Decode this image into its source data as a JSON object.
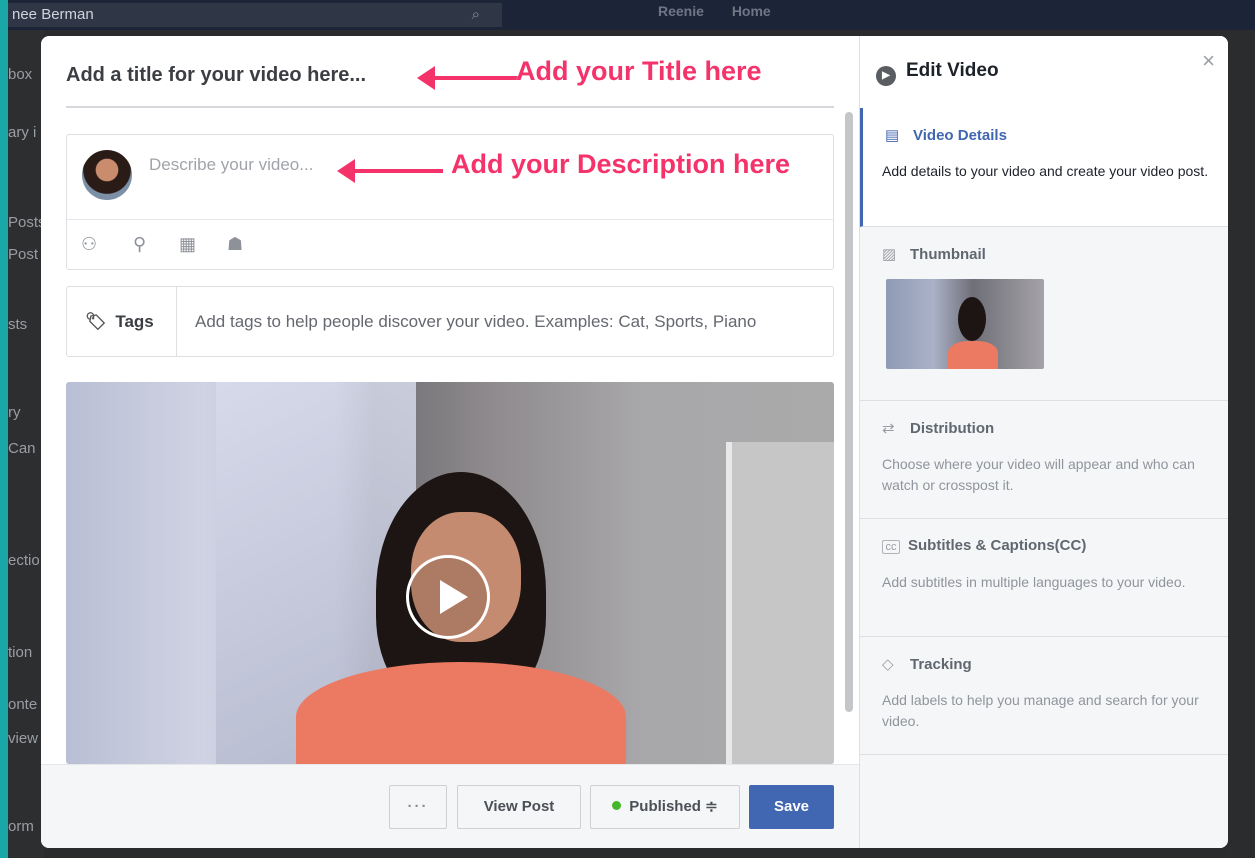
{
  "background_page": {
    "search_text": "nee Berman",
    "nav_name": "Reenie",
    "nav_home": "Home",
    "side_labels": [
      "box",
      "ary i",
      "Posts",
      "Post",
      "sts",
      "ry",
      "Can",
      "ectio",
      "tion",
      "onte",
      "view",
      "orm"
    ]
  },
  "modal": {
    "title_placeholder": "Add a title for your video here...",
    "description_placeholder": "Describe your video...",
    "annotations": {
      "title": "Add your Title here",
      "description": "Add your Description here"
    },
    "tags": {
      "label": "Tags",
      "placeholder": "Add tags to help people discover your video. Examples: Cat, Sports, Piano"
    },
    "footer": {
      "more_label": "···",
      "view_post_label": "View Post",
      "publish_status_label": "Published ≑",
      "save_label": "Save"
    }
  },
  "edit_panel": {
    "title": "Edit Video",
    "close_label": "×",
    "sections": [
      {
        "title": "Video Details",
        "description": "Add details to your video and create your video post.",
        "active": true,
        "icon": "video-details-icon"
      },
      {
        "title": "Thumbnail",
        "description": "",
        "active": false,
        "icon": "image-icon"
      },
      {
        "title": "Distribution",
        "description": "Choose where your video will appear and who can watch or crosspost it.",
        "active": false,
        "icon": "distribution-icon"
      },
      {
        "title": "Subtitles & Captions(CC)",
        "description": "Add subtitles in multiple languages to your video.",
        "active": false,
        "icon": "cc-icon"
      },
      {
        "title": "Tracking",
        "description": "Add labels to help you manage and search for your video.",
        "active": false,
        "icon": "tag-icon"
      }
    ]
  },
  "colors": {
    "accent": "#4267b2",
    "annotation": "#f4336b",
    "published_dot": "#42b72a",
    "frame": "#1aa7a8"
  }
}
